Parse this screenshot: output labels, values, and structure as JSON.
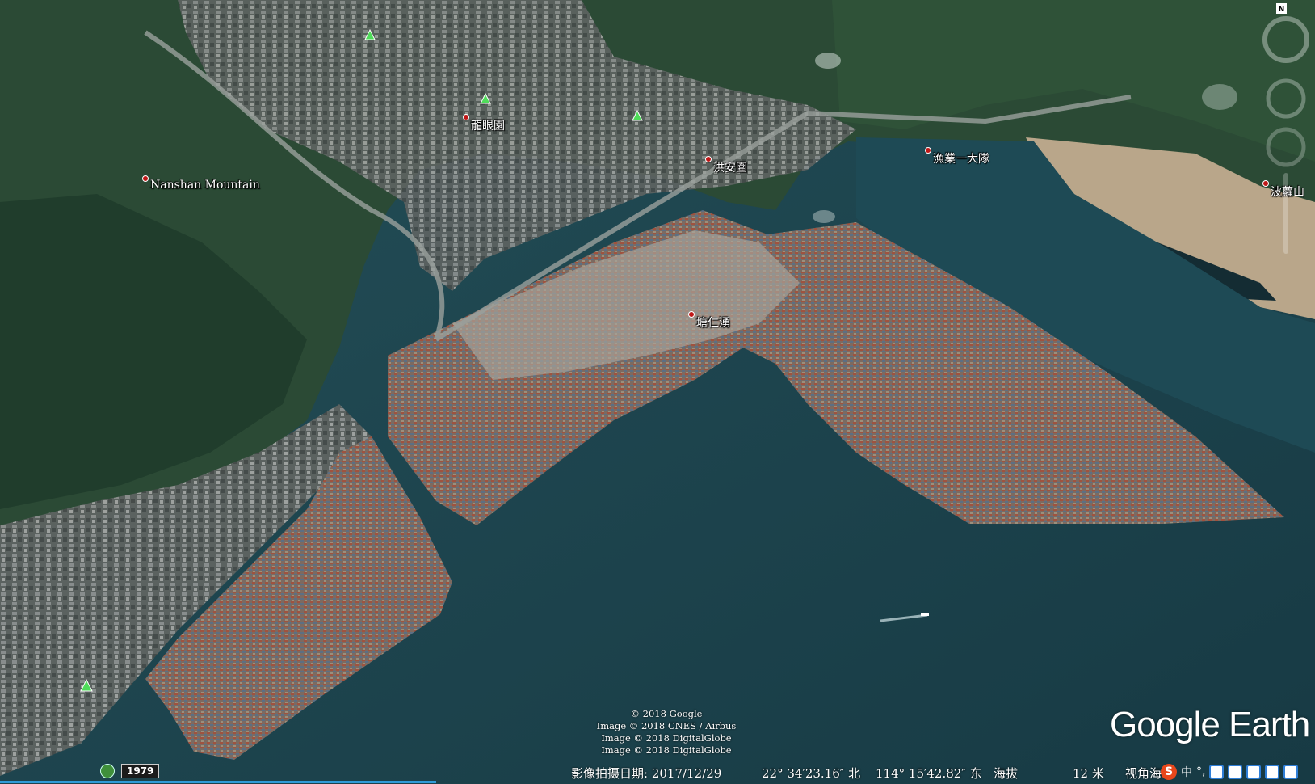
{
  "map": {
    "labels": [
      {
        "id": "nanshan",
        "text": "Nanshan Mountain"
      },
      {
        "id": "longyan",
        "text": "龍眼園"
      },
      {
        "id": "hongan",
        "text": "洪安圍"
      },
      {
        "id": "yuye",
        "text": "漁業一大隊"
      },
      {
        "id": "tangren",
        "text": "塘仁湧"
      },
      {
        "id": "bolan",
        "text": "波蘿山"
      }
    ],
    "colors": {
      "water": "#1d4a55",
      "forest": "#2d4a33",
      "urban": "#6f7070",
      "containers": "#8a6a5c"
    }
  },
  "attribution": {
    "lines": [
      "© 2018 Google",
      "Image © 2018 CNES / Airbus",
      "Image © 2018 DigitalGlobe",
      "Image © 2018 DigitalGlobe"
    ]
  },
  "brand": {
    "logo": "Google Earth"
  },
  "status": {
    "year": "1979",
    "capture_date": "影像拍摄日期: 2017/12/29",
    "latitude": "22° 34′23.16″ 北",
    "longitude": "114° 15′42.82″ 东",
    "elevation_label": "海拔",
    "elevation_value": "12 米",
    "view_angle": "视角海"
  },
  "controls": {
    "compass_letter": "N",
    "ime_lang": "中",
    "ime_punct": "°,"
  }
}
